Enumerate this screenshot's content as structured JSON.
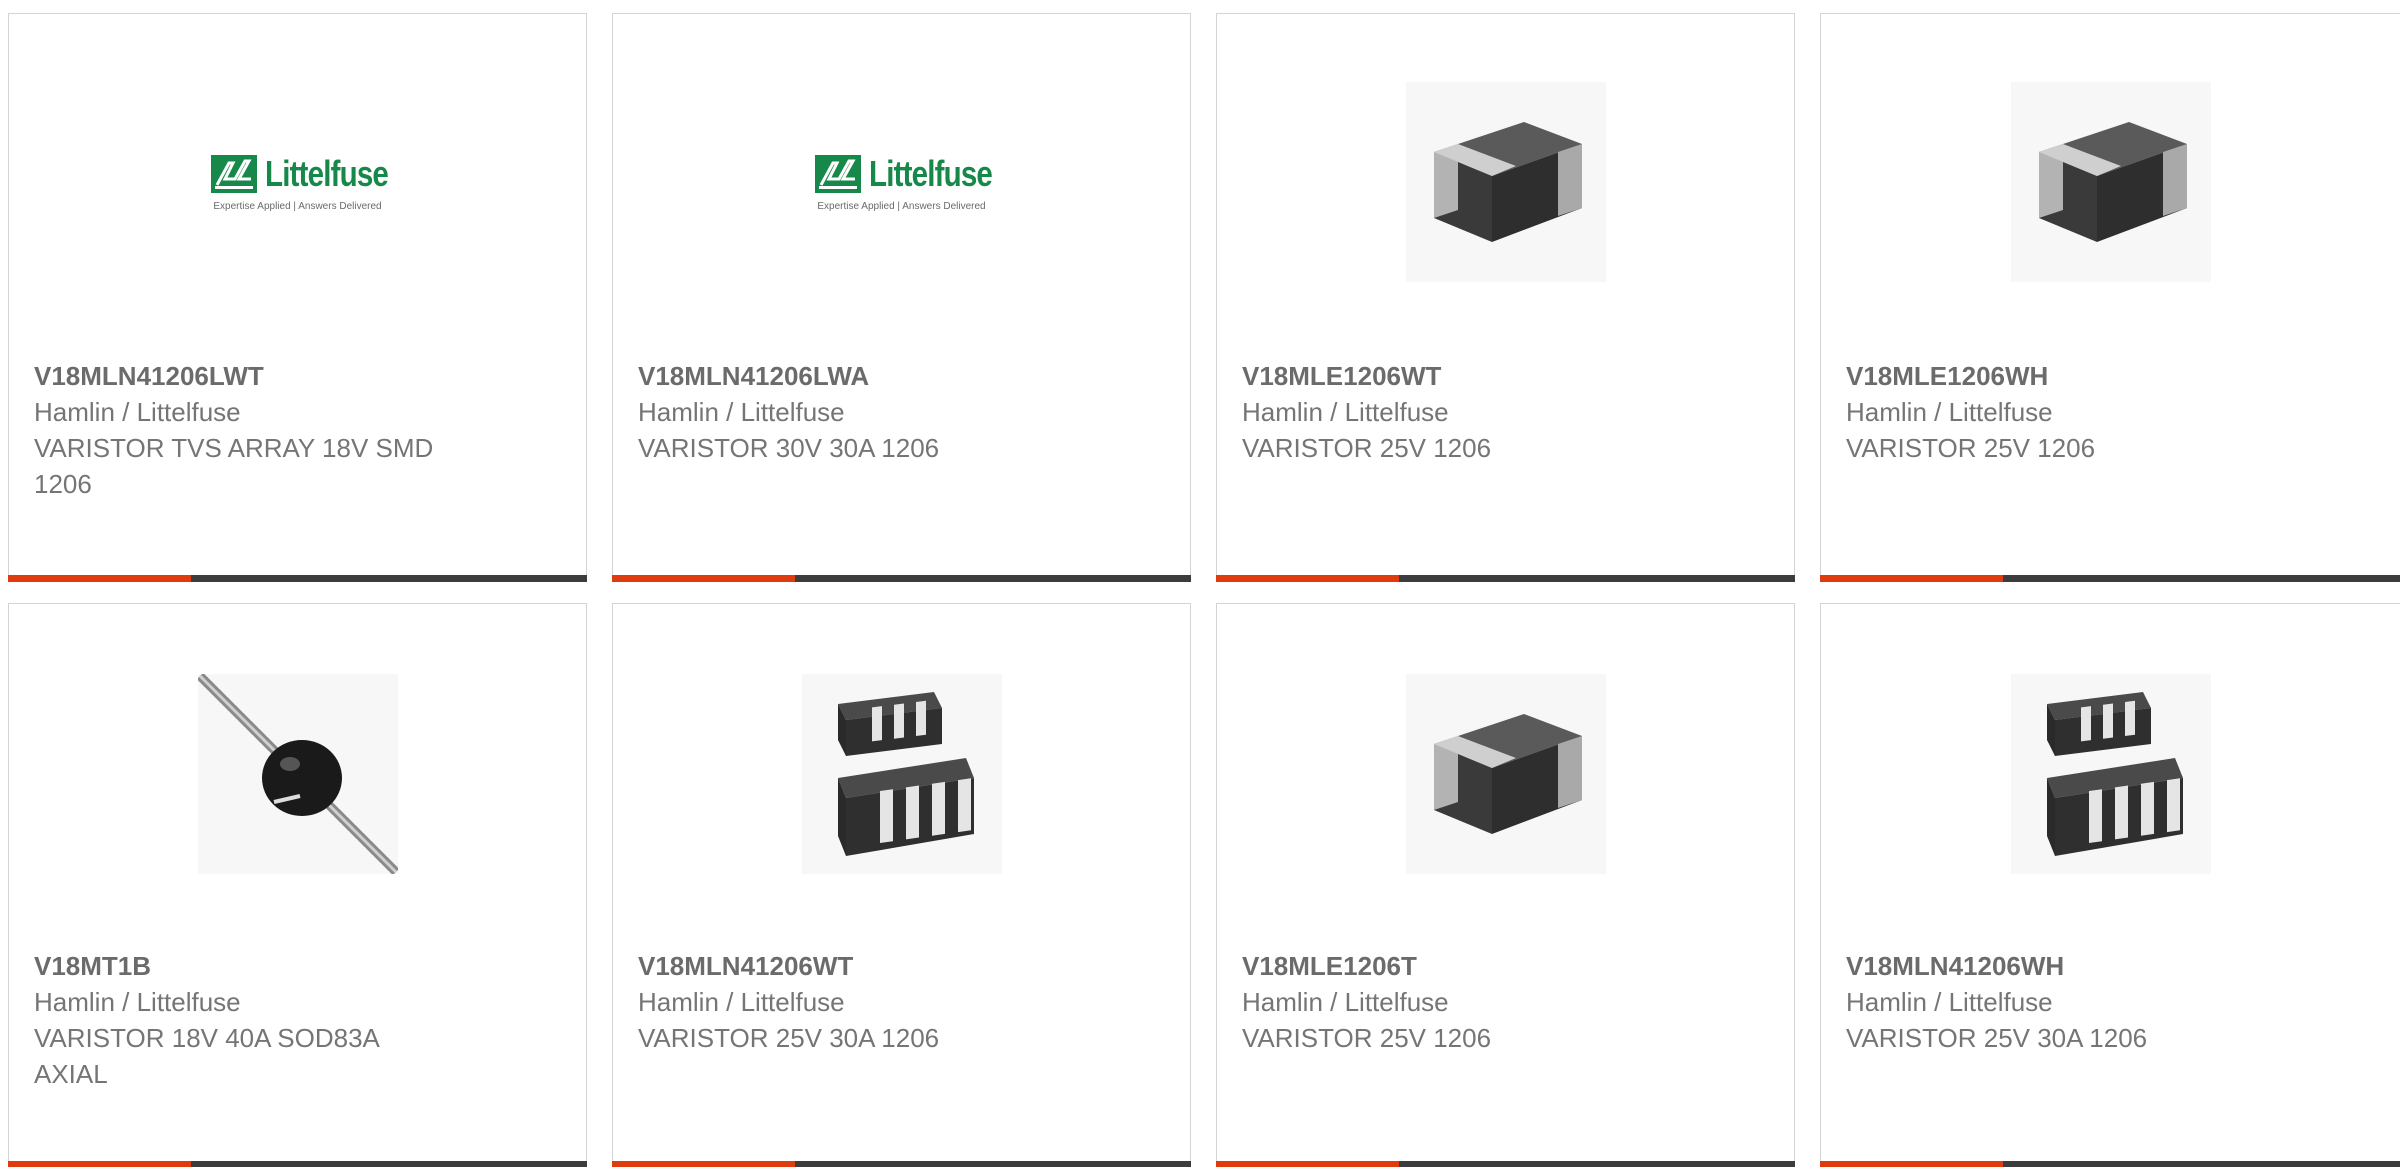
{
  "colors": {
    "accent": "#e03a0f",
    "bar": "#3b3c3e",
    "brand_green": "#16884a",
    "text": "#757575"
  },
  "products": [
    {
      "part": "V18MLN41206LWT",
      "manufacturer": "Hamlin / Littelfuse",
      "description": "VARISTOR TVS ARRAY 18V SMD 1206",
      "image": "littelfuse-logo",
      "logo_word": "Littelfuse",
      "logo_tagline": "Expertise Applied | Answers Delivered"
    },
    {
      "part": "V18MLN41206LWA",
      "manufacturer": "Hamlin / Littelfuse",
      "description": "VARISTOR 30V 30A 1206",
      "image": "littelfuse-logo",
      "logo_word": "Littelfuse",
      "logo_tagline": "Expertise Applied | Answers Delivered"
    },
    {
      "part": "V18MLE1206WT",
      "manufacturer": "Hamlin / Littelfuse",
      "description": "VARISTOR 25V 1206",
      "image": "chip-component-photo"
    },
    {
      "part": "V18MLE1206WH",
      "manufacturer": "Hamlin / Littelfuse",
      "description": "VARISTOR 25V 1206",
      "image": "chip-component-photo"
    },
    {
      "part": "V18MT1B",
      "manufacturer": "Hamlin / Littelfuse",
      "description": "VARISTOR 18V 40A SOD83A AXIAL",
      "image": "axial-component-photo"
    },
    {
      "part": "V18MLN41206WT",
      "manufacturer": "Hamlin / Littelfuse",
      "description": "VARISTOR 25V 30A 1206",
      "image": "array-component-photo"
    },
    {
      "part": "V18MLE1206T",
      "manufacturer": "Hamlin / Littelfuse",
      "description": "VARISTOR 25V 1206",
      "image": "chip-component-photo"
    },
    {
      "part": "V18MLN41206WH",
      "manufacturer": "Hamlin / Littelfuse",
      "description": "VARISTOR 25V 30A 1206",
      "image": "array-component-photo"
    }
  ]
}
